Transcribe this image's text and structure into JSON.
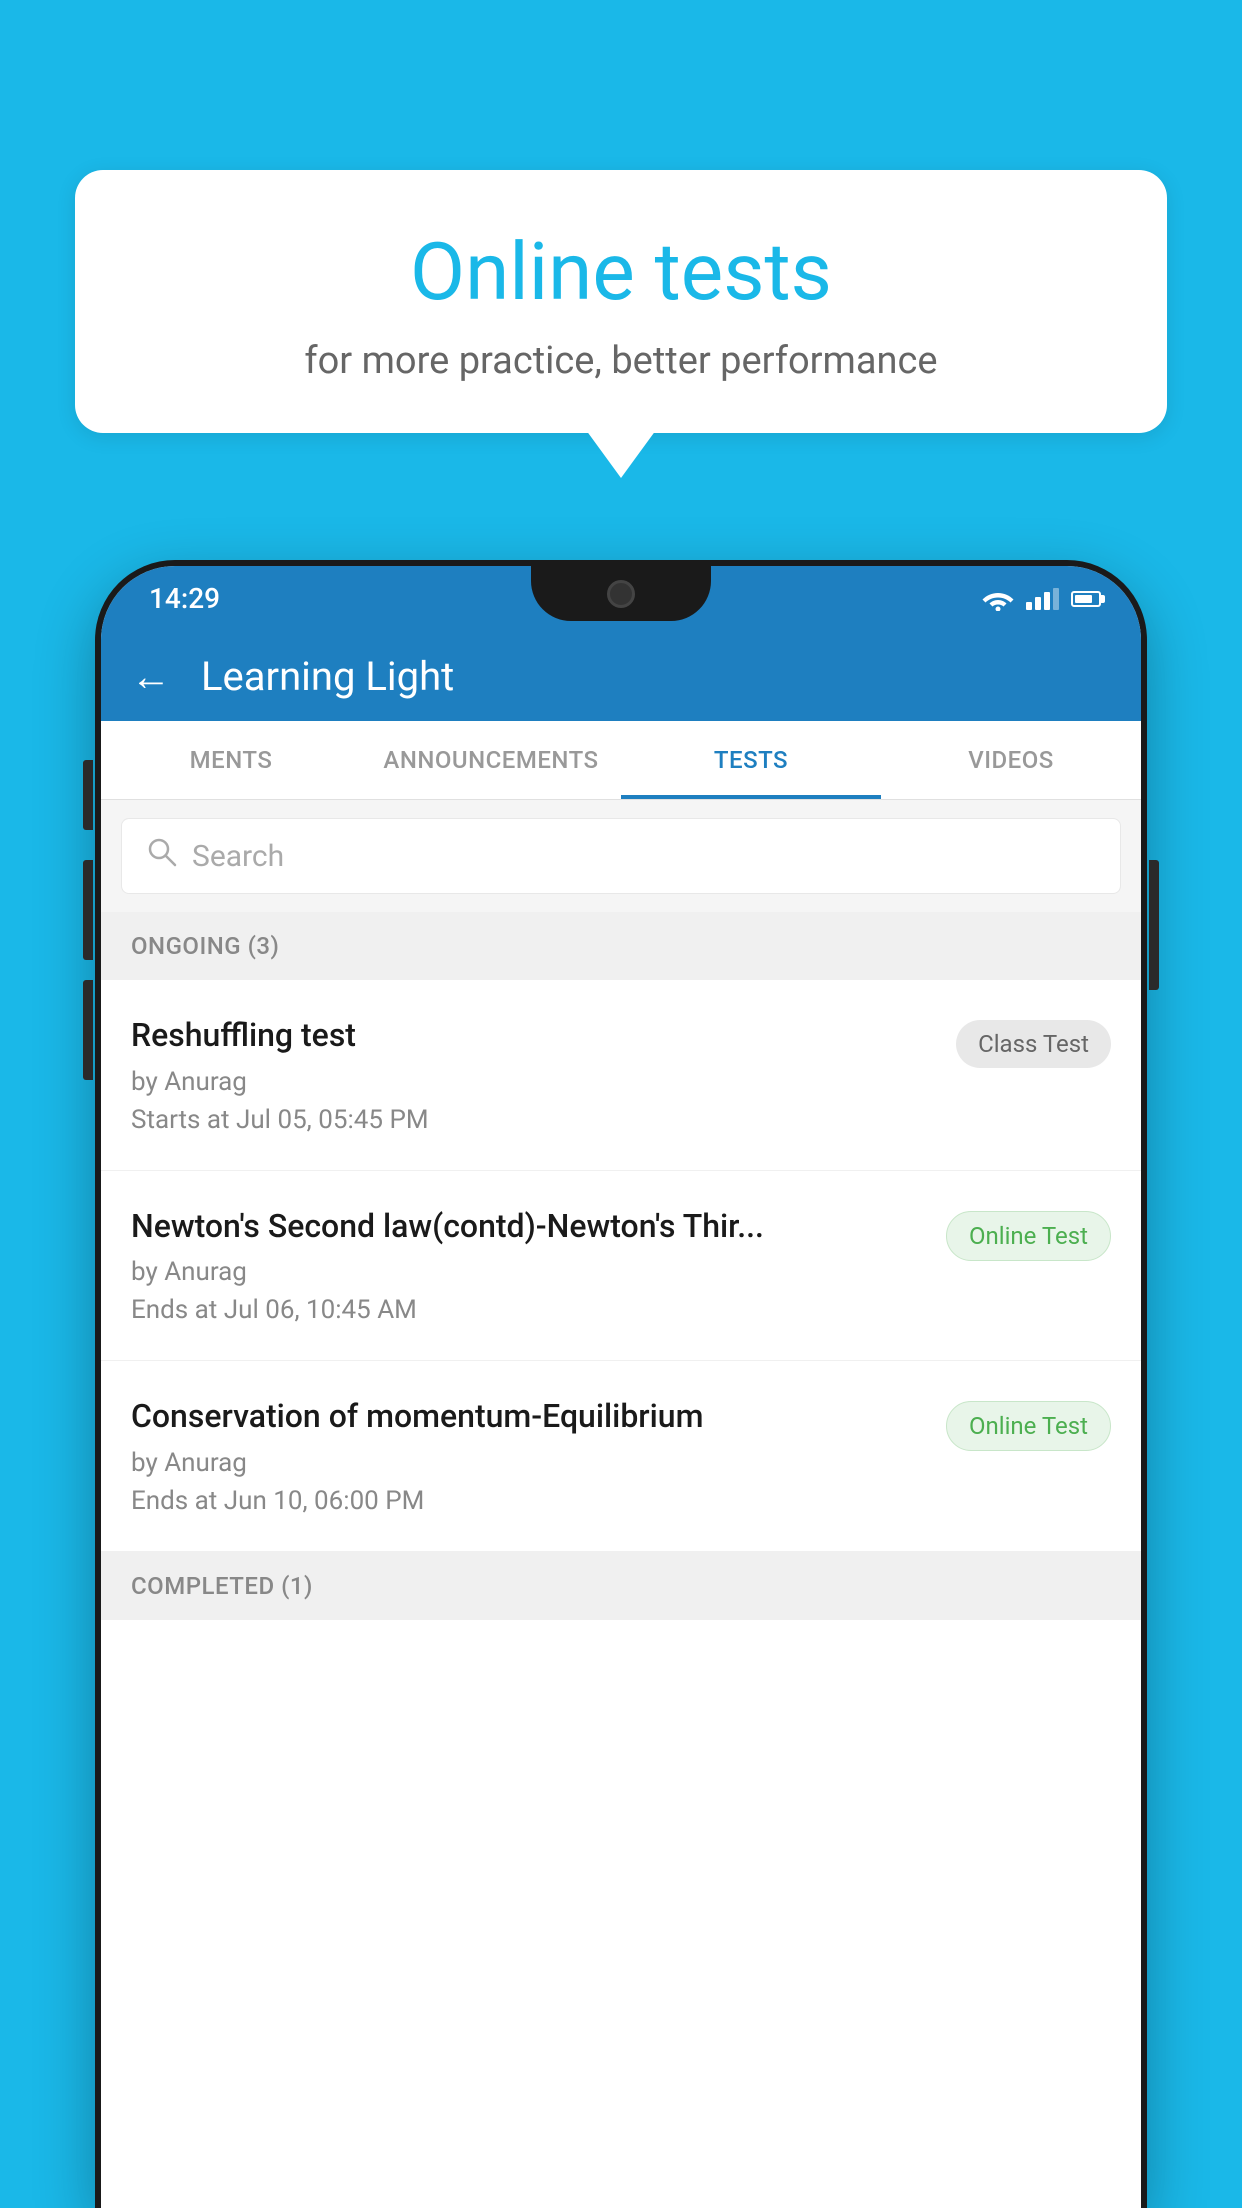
{
  "background": {
    "color": "#1ab8e8"
  },
  "speech_bubble": {
    "title": "Online tests",
    "subtitle": "for more practice, better performance"
  },
  "phone": {
    "status_bar": {
      "time": "14:29"
    },
    "header": {
      "title": "Learning Light",
      "back_label": "←"
    },
    "tabs": [
      {
        "label": "MENTS",
        "active": false
      },
      {
        "label": "ANNOUNCEMENTS",
        "active": false
      },
      {
        "label": "TESTS",
        "active": true
      },
      {
        "label": "VIDEOS",
        "active": false
      }
    ],
    "search": {
      "placeholder": "Search"
    },
    "sections": [
      {
        "header": "ONGOING (3)",
        "tests": [
          {
            "name": "Reshuffling test",
            "author": "by Anurag",
            "date": "Starts at  Jul 05, 05:45 PM",
            "badge": "Class Test",
            "badge_type": "class"
          },
          {
            "name": "Newton's Second law(contd)-Newton's Thir...",
            "author": "by Anurag",
            "date": "Ends at  Jul 06, 10:45 AM",
            "badge": "Online Test",
            "badge_type": "online"
          },
          {
            "name": "Conservation of momentum-Equilibrium",
            "author": "by Anurag",
            "date": "Ends at  Jun 10, 06:00 PM",
            "badge": "Online Test",
            "badge_type": "online"
          }
        ]
      },
      {
        "header": "COMPLETED (1)",
        "tests": []
      }
    ]
  }
}
